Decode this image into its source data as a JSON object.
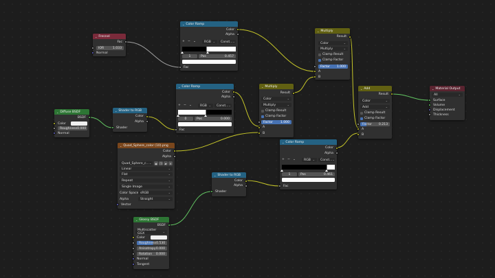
{
  "colors": {
    "input_hdr": "#7a2a3a",
    "converter_hdr": "#246283",
    "shader_hdr": "#2d7534",
    "texture_hdr": "#7a461c",
    "output_hdr": "#5a2430",
    "math_hdr": "#616012",
    "grey_sock": "#a1a1a1",
    "yellow_sock": "#c7c729",
    "green_sock": "#63c763",
    "purple_sock": "#6363c7",
    "wire": "#b4b446",
    "wire_green": "#63c763"
  },
  "fresnel": {
    "title": "Fresnel",
    "fac": "Fac",
    "ior_label": "IOR",
    "ior_value": "1.033",
    "normal": "Normal"
  },
  "cr1": {
    "title": "Color Ramp",
    "out_color": "Color",
    "out_alpha": "Alpha",
    "plus": "+",
    "minus": "−",
    "mode": "RGB",
    "interp": "Const...",
    "index": "1",
    "pos_label": "Pos",
    "pos_value": "0.457",
    "in_fac": "Fac"
  },
  "cr2": {
    "title": "Color Ramp",
    "out_color": "Color",
    "out_alpha": "Alpha",
    "plus": "+",
    "minus": "−",
    "mode": "RGB",
    "interp": "Const...",
    "index": "0",
    "pos_label": "Pos",
    "pos_value": "0.000",
    "in_fac": "Fac"
  },
  "cr3": {
    "title": "Color Ramp",
    "out_color": "Color",
    "out_alpha": "Alpha",
    "plus": "+",
    "minus": "−",
    "mode": "RGB",
    "interp": "Const...",
    "index": "1",
    "pos_label": "Pos",
    "pos_value": "0.461",
    "in_fac": "Fac"
  },
  "diffuse": {
    "title": "Diffuse BSDF",
    "bsdf": "BSDF",
    "color": "Color",
    "rough_label": "Roughness",
    "rough_value": "0.000",
    "normal": "Normal"
  },
  "s2r1": {
    "title": "Shader to RGB",
    "color": "Color",
    "alpha": "Alpha",
    "shader": "Shader"
  },
  "s2r2": {
    "title": "Shader to RGB",
    "color": "Color",
    "alpha": "Alpha",
    "shader": "Shader"
  },
  "mul1": {
    "title": "Multiply",
    "result": "Result",
    "type": "Color",
    "blend": "Multiply",
    "clamp_result": "Clamp Result",
    "clamp_factor": "Clamp Factor",
    "factor_label": "Factor",
    "factor_value": "1.000",
    "a": "A",
    "b": "B"
  },
  "mul2": {
    "title": "Multiply",
    "result": "Result",
    "type": "Color",
    "blend": "Multiply",
    "clamp_result": "Clamp Result",
    "clamp_factor": "Clamp Factor",
    "factor_label": "Factor",
    "factor_value": "1.000",
    "a": "A",
    "b": "B"
  },
  "add": {
    "title": "Add",
    "result": "Result",
    "type": "Color",
    "blend": "Add",
    "clamp_result": "Clamp Result",
    "clamp_factor": "Clamp Factor",
    "factor_label": "Factor",
    "factor_value": "0.213",
    "a": "A",
    "b": "B"
  },
  "output": {
    "title": "Material Output",
    "target": "All",
    "surface": "Surface",
    "volume": "Volume",
    "displacement": "Displacement",
    "thickness": "Thickness"
  },
  "img": {
    "title": "Quad_Sphere_color (10).png",
    "out_color": "Color",
    "out_alpha": "Alpha",
    "image_name": "Quad_Sphere_c...",
    "interp": "Linear",
    "projection": "Flat",
    "extension": "Repeat",
    "source": "Single Image",
    "cs_label": "Color Space",
    "cs_value": "sRGB",
    "alpha_label": "Alpha",
    "alpha_value": "Straight",
    "vector": "Vector"
  },
  "glossy": {
    "title": "Glossy BSDF",
    "bsdf": "BSDF",
    "distribution": "Multiscatter GGX",
    "color": "Color",
    "rough_label": "Roughness",
    "rough_value": "0.530",
    "aniso_label": "Anisotropy",
    "aniso_value": "0.000",
    "rot_label": "Rotation",
    "rot_value": "0.000",
    "normal": "Normal",
    "tangent": "Tangent"
  }
}
